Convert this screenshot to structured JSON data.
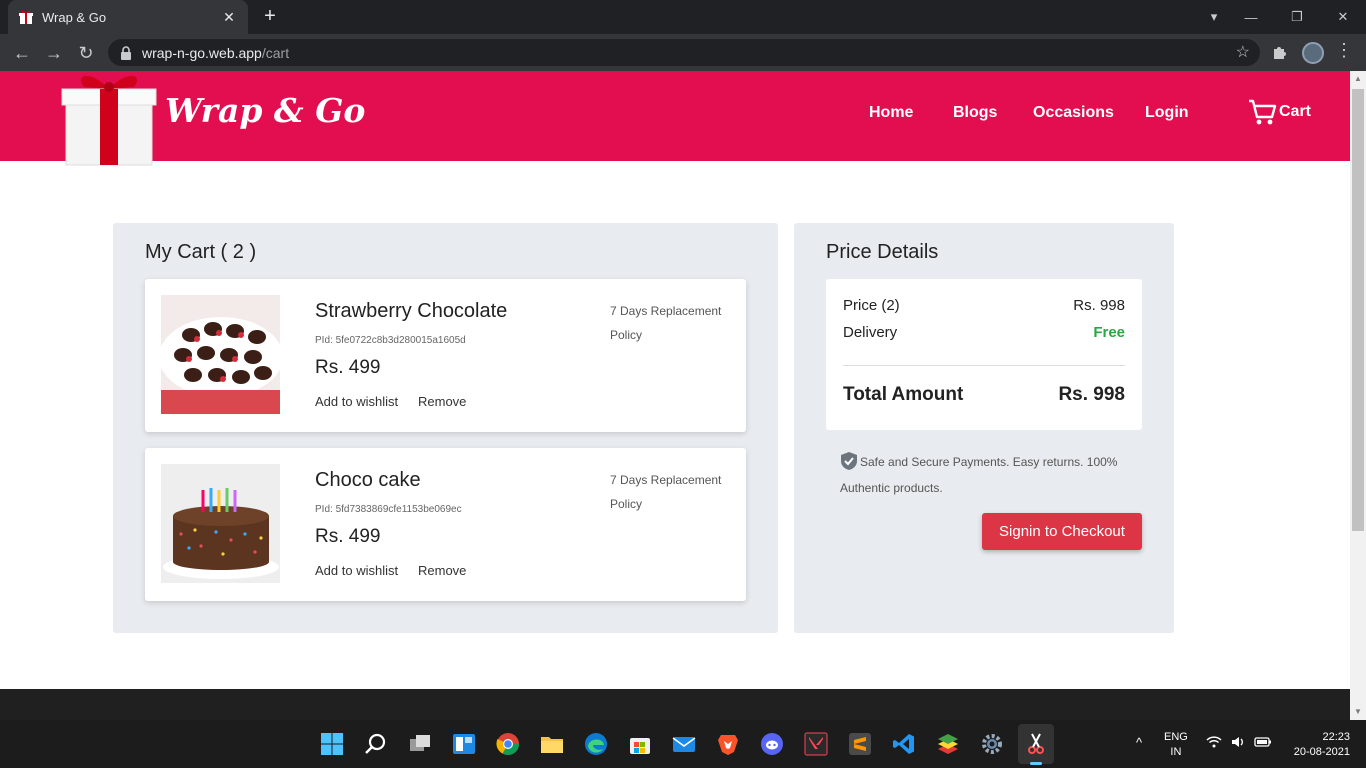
{
  "browser": {
    "tab_title": "Wrap & Go",
    "tab_close": "✕",
    "new_tab": "+",
    "url_host": "wrap-n-go.web.app",
    "url_path": "/cart",
    "back": "←",
    "forward": "→",
    "reload": "↻",
    "star": "☆",
    "menu": "⋮",
    "minimize": "—",
    "restore": "❐",
    "close": "✕",
    "tab_search": "▾"
  },
  "header": {
    "logo_text": "Wrap & Go",
    "nav": {
      "home": "Home",
      "blogs": "Blogs",
      "occasions": "Occasions",
      "login": "Login",
      "cart": "Cart"
    },
    "brand_color": "#e20e4f"
  },
  "cart": {
    "title": "My Cart ( 2 )",
    "items": [
      {
        "name": "Strawberry Chocolate",
        "pid": "PId: 5fe0722c8b3d280015a1605d",
        "price": "Rs. 499",
        "wishlist": "Add to wishlist",
        "remove": "Remove",
        "policy": "7 Days Replacement Policy"
      },
      {
        "name": "Choco cake",
        "pid": "PId: 5fd7383869cfe1153be069ec",
        "price": "Rs. 499",
        "wishlist": "Add to wishlist",
        "remove": "Remove",
        "policy": "7 Days Replacement Policy"
      }
    ]
  },
  "price": {
    "title": "Price Details",
    "price_label": "Price (2)",
    "price_value": "Rs. 998",
    "delivery_label": "Delivery",
    "delivery_value": "Free",
    "total_label": "Total Amount",
    "total_value": "Rs. 998",
    "secure_text": "Safe and Secure Payments. Easy returns. 100% Authentic products.",
    "checkout_label": "Signin to Checkout",
    "checkout_color": "#dc3545"
  },
  "taskbar": {
    "lang_top": "ENG",
    "lang_bottom": "IN",
    "time": "22:23",
    "date": "20-08-2021",
    "chevron": "^"
  }
}
